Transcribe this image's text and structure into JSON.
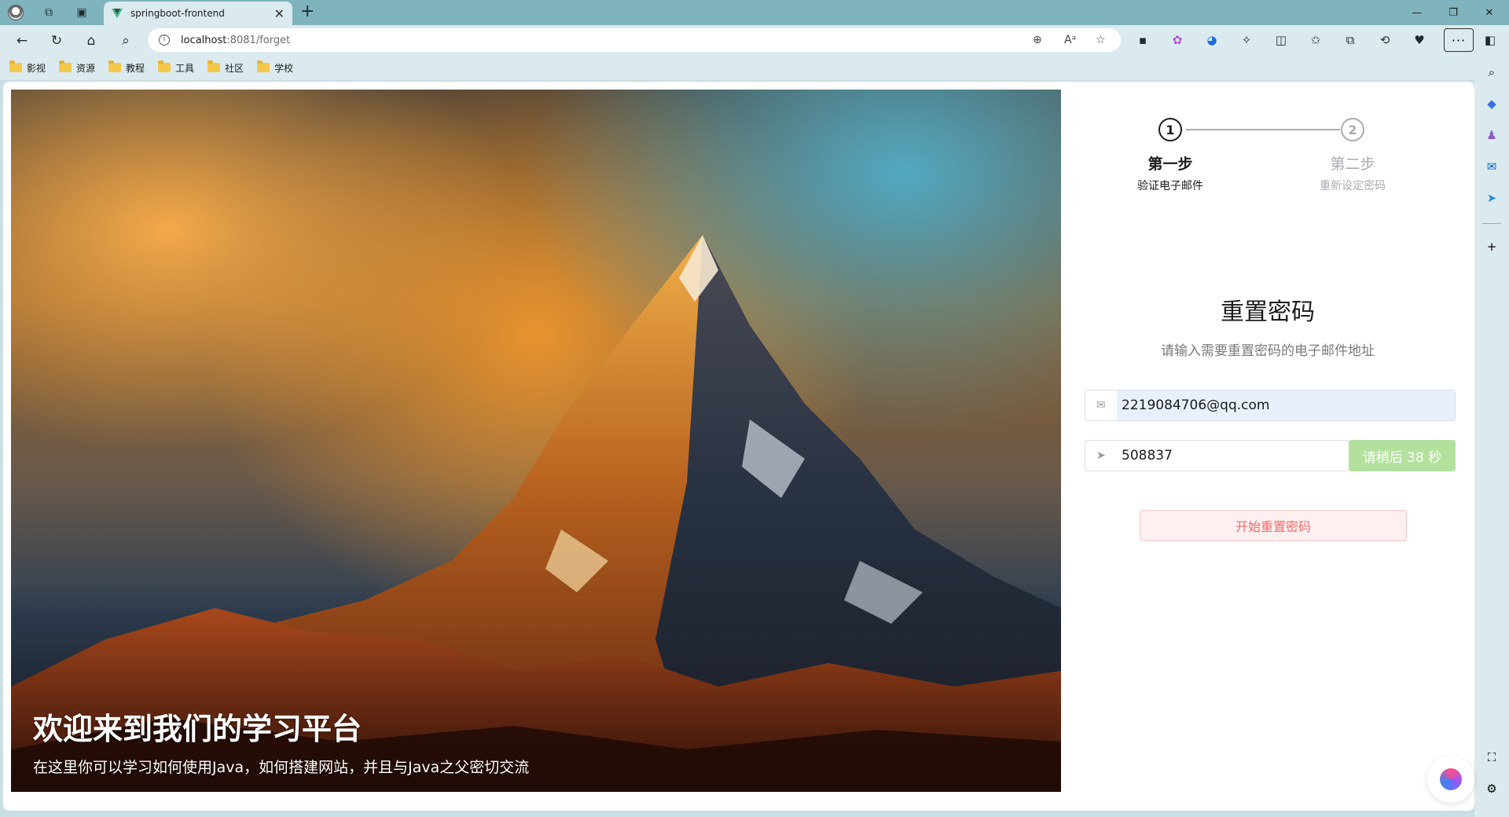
{
  "browser": {
    "tab_title": "springboot-frontend",
    "address_host": "localhost",
    "address_path": ":8081/forget",
    "bookmarks": [
      "影视",
      "资源",
      "教程",
      "工具",
      "社区",
      "学校"
    ]
  },
  "hero": {
    "title": "欢迎来到我们的学习平台",
    "subtitle": "在这里你可以学习如何使用Java，如何搭建网站，并且与Java之父密切交流"
  },
  "steps": [
    {
      "number": "1",
      "title": "第一步",
      "desc": "验证电子邮件",
      "active": true
    },
    {
      "number": "2",
      "title": "第二步",
      "desc": "重新设定密码",
      "active": false
    }
  ],
  "form": {
    "title": "重置密码",
    "subtitle": "请输入需要重置密码的电子邮件地址",
    "email_value": "2219084706@qq.com",
    "code_value": "508837",
    "code_button": "请稍后 38 秒",
    "submit_button": "开始重置密码"
  },
  "colors": {
    "accent_success_light": "#b3e19d",
    "danger": "#f56c6c",
    "danger_bg": "#fef0f0",
    "active_step": "#1b1b1b",
    "inactive_step": "#a8abb2"
  }
}
